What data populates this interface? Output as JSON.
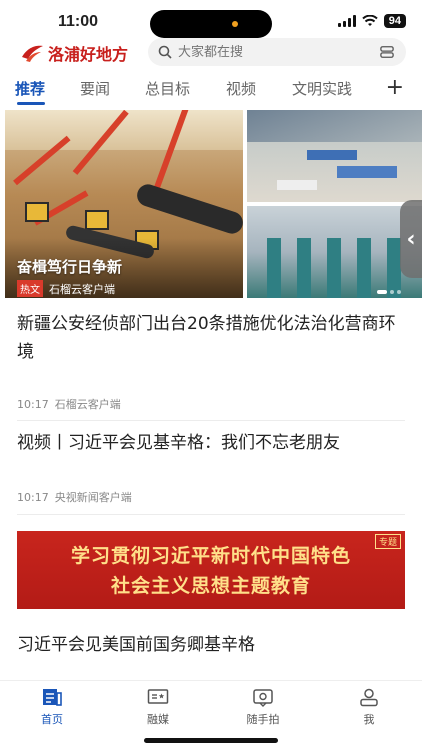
{
  "status_bar": {
    "time": "11:00",
    "battery": "94"
  },
  "header": {
    "app_name": "洛浦好地方",
    "search_placeholder": "大家都在搜"
  },
  "tabs": [
    {
      "label": "推荐",
      "active": true
    },
    {
      "label": "要闻"
    },
    {
      "label": "总目标"
    },
    {
      "label": "视频"
    },
    {
      "label": "文明实践"
    }
  ],
  "tab_add": "+",
  "carousel": {
    "title": "奋楫笃行日争新",
    "tag": "热文",
    "source": "石榴云客户端"
  },
  "news": [
    {
      "title": "新疆公安经侦部门出台20条措施优化法治化营商环境",
      "time": "10:17",
      "source": "石榴云客户端"
    },
    {
      "title": "视频丨习近平会见基辛格：我们不忘老朋友",
      "time": "10:17",
      "source": "央视新闻客户端"
    },
    {
      "title": "习近平会见美国前国务卿基辛格"
    }
  ],
  "banner": {
    "line1": "学习贯彻习近平新时代中国特色",
    "line2": "社会主义思想主题教育",
    "tag": "专题"
  },
  "bottom_nav": [
    {
      "label": "首页",
      "icon": "home-news-icon",
      "active": true
    },
    {
      "label": "融媒",
      "icon": "media-tv-icon"
    },
    {
      "label": "随手拍",
      "icon": "camera-icon"
    },
    {
      "label": "我",
      "icon": "person-icon"
    }
  ],
  "colors": {
    "brand_red": "#c8201d",
    "accent_blue": "#1a56b8"
  }
}
